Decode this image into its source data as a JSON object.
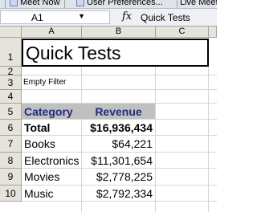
{
  "toolbar": {
    "meet_now": "Meet Now",
    "user_prefs": "User Preferences...",
    "live_meeting": "Live Meetin"
  },
  "formula_bar": {
    "name_box": "A1",
    "fx_symbol": "fx",
    "content": "Quick Tests"
  },
  "columns": [
    "A",
    "B",
    "C"
  ],
  "rows": [
    "1",
    "2",
    "3",
    "4",
    "5",
    "6",
    "7",
    "8",
    "9",
    "10"
  ],
  "sheet": {
    "title": "Quick Tests",
    "filter_note": "Empty Filter",
    "table_header": {
      "category": "Category",
      "revenue": "Revenue"
    },
    "total": {
      "label": "Total",
      "value": "$16,936,434"
    },
    "items": [
      {
        "category": "Books",
        "revenue": "$64,221"
      },
      {
        "category": "Electronics",
        "revenue": "$11,301,654"
      },
      {
        "category": "Movies",
        "revenue": "$2,778,225"
      },
      {
        "category": "Music",
        "revenue": "$2,792,334"
      }
    ]
  },
  "colors": {
    "header_fill": "#c0c0c0",
    "header_text": "#1f2b80",
    "grid_header": "#e6e3dc"
  }
}
